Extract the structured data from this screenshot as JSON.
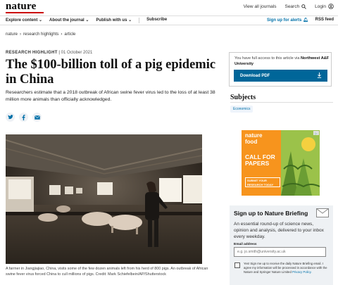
{
  "header": {
    "logo": "nature",
    "links": [
      "View all journals",
      "Search",
      "Login"
    ]
  },
  "nav": {
    "left": [
      "Explore content",
      "About the journal",
      "Publish with us",
      "Subscribe"
    ],
    "sign_up_alerts": "Sign up for alerts",
    "rss": "RSS feed"
  },
  "breadcrumb": [
    "nature",
    "research highlights",
    "article"
  ],
  "article": {
    "type": "RESEARCH HIGHLIGHT",
    "date": "01 October 2021",
    "title": "The $100-billion toll of a pig epidemic in China",
    "standfirst": "Researchers estimate that a 2018 outbreak of African swine fever virus led to the loss of at least 38 million more animals than officially acknowledged.",
    "caption": "A farmer in Jiangjiajiao, China, visits some of the few dozen animals left from his herd of 800 pigs. An outbreak of African swine fever virus forced China to cull millions of pigs. Credit: Mark Schiefelbein/AP/Shutterstock"
  },
  "sidebar": {
    "access_text": "You have full access to this article via",
    "institution": "Northwest A&F University",
    "download_pdf": "Download PDF",
    "subjects_title": "Subjects",
    "subject": "Economics",
    "ad": {
      "brand_line1": "nature",
      "brand_line2": "food",
      "call_line1": "CALL FOR",
      "call_line2": "PAPERS",
      "submit": "SUBMIT YOUR RESEARCH TODAY"
    },
    "briefing": {
      "title": "Sign up to Nature Briefing",
      "description": "An essential round-up of science news, opinion and analysis, delivered to your inbox every weekday.",
      "email_label": "Email address",
      "email_placeholder": "e.g. jo.smith@university.ac.uk",
      "consent": "Yes! Sign me up to receive the daily Nature Briefing email. I agree my information will be processed in accordance with the Nature and Springer Nature Limited",
      "privacy_link": "Privacy Policy."
    }
  },
  "colors": {
    "accent": "#006699",
    "logo_red": "#cc0000",
    "ad_orange": "#f7941d",
    "ad_green": "#9bc24a",
    "briefing_bg": "#eef1f4"
  }
}
